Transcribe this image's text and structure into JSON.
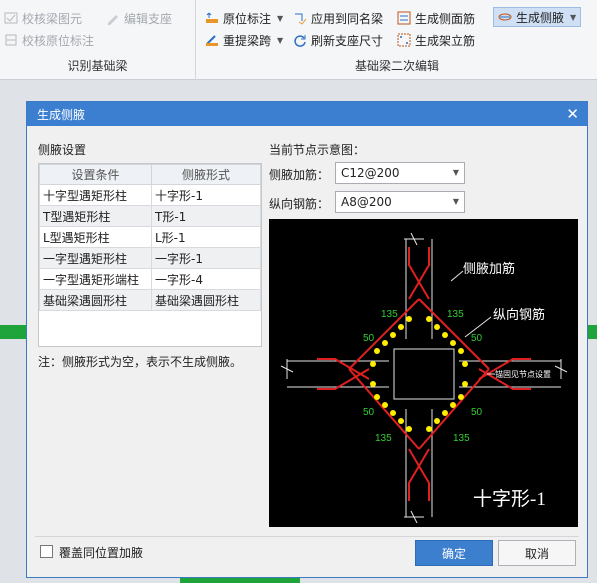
{
  "ribbon": {
    "group1": {
      "label": "识别基础梁",
      "btn_check_beam": "校核梁图元",
      "btn_edit_support": "编辑支座",
      "btn_check_origin": "校核原位标注"
    },
    "group2": {
      "label": "基础梁二次编辑",
      "btn_origin_mark": "原位标注",
      "btn_apply_same": "应用到同名梁",
      "btn_gen_side_rebar": "生成侧面筋",
      "btn_gen_haunch": "生成侧腋",
      "btn_re_span": "重提梁跨",
      "btn_refresh_support": "刷新支座尺寸",
      "btn_gen_stirrup": "生成架立筋"
    }
  },
  "dialog": {
    "title": "生成侧腋",
    "section_label": "侧腋设置",
    "preview_label": "当前节点示意图：",
    "table": {
      "headers": [
        "设置条件",
        "侧腋形式"
      ],
      "rows": [
        [
          "十字型遇矩形柱",
          "十字形-1"
        ],
        [
          "T型遇矩形柱",
          "T形-1"
        ],
        [
          "L型遇矩形柱",
          "L形-1"
        ],
        [
          "一字型遇矩形柱",
          "一字形-1"
        ],
        [
          "一字型遇矩形端柱",
          "一字形-4"
        ],
        [
          "基础梁遇圆形柱",
          "基础梁遇圆形柱"
        ]
      ]
    },
    "note": "注：侧腋形式为空，表示不生成侧腋。",
    "haunch_rebar_label": "侧腋加筋：",
    "haunch_rebar_value": "C12@200",
    "long_rebar_label": "纵向钢筋：",
    "long_rebar_value": "A8@200",
    "diagram": {
      "label_haunch": "侧腋加筋",
      "label_long": "纵向钢筋",
      "label_anchor": "锚固见节点设置",
      "dim_135": "135",
      "dim_50": "50",
      "shape_name": "十字形-1"
    },
    "checkbox_label": "覆盖同位置加腋",
    "ok": "确定",
    "cancel": "取消"
  },
  "colors": {
    "title_bar": "#3c7fd0",
    "rebar": "#e02020",
    "dots": "#ffee00",
    "dim_text": "#33cc33"
  }
}
